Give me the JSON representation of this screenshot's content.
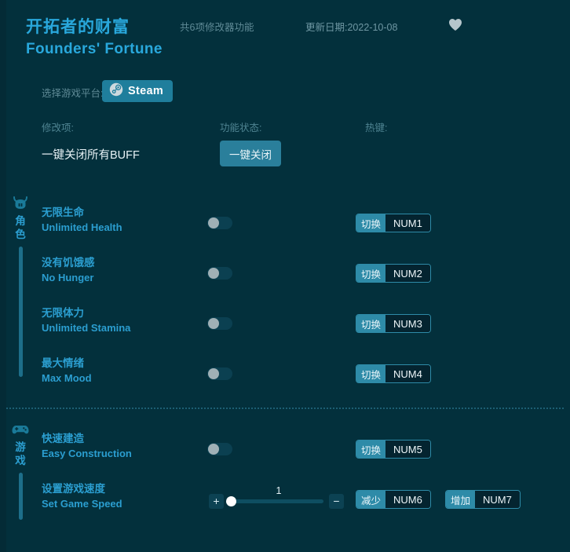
{
  "header": {
    "title_cn": "开拓者的财富",
    "title_en": "Founders' Fortune",
    "feature_count": "共6项修改器功能",
    "update_date": "更新日期:2022-10-08",
    "favorite_icon": "heart-icon",
    "platform_label": "选择游戏平台:",
    "platform_button": "Steam",
    "platform_icon": "steam-icon"
  },
  "columns": {
    "option": "修改项:",
    "status": "功能状态:",
    "hotkey": "热键:"
  },
  "close_all": {
    "label": "一键关闭所有BUFF",
    "button": "一键关闭"
  },
  "colors": {
    "background": "#03303c",
    "accent": "#29a8dc",
    "teal": "#2e8ba8",
    "button": "#2a7f9b",
    "muted": "#5f8a96",
    "rail": "#1d6e8a"
  },
  "sections": [
    {
      "name": "角色",
      "icon": "character-helmet-icon",
      "rows": [
        {
          "cn": "无限生命",
          "en": "Unlimited Health",
          "control": "toggle",
          "toggle_state": "off",
          "hotkeys": [
            {
              "action": "切换",
              "key": "NUM1"
            }
          ]
        },
        {
          "cn": "没有饥饿感",
          "en": "No Hunger",
          "control": "toggle",
          "toggle_state": "off",
          "hotkeys": [
            {
              "action": "切换",
              "key": "NUM2"
            }
          ]
        },
        {
          "cn": "无限体力",
          "en": "Unlimited Stamina",
          "control": "toggle",
          "toggle_state": "off",
          "hotkeys": [
            {
              "action": "切换",
              "key": "NUM3"
            }
          ]
        },
        {
          "cn": "最大情绪",
          "en": "Max Mood",
          "control": "toggle",
          "toggle_state": "off",
          "hotkeys": [
            {
              "action": "切换",
              "key": "NUM4"
            }
          ]
        }
      ]
    },
    {
      "name": "游戏",
      "icon": "gamepad-icon",
      "rows": [
        {
          "cn": "快速建造",
          "en": "Easy Construction",
          "control": "toggle",
          "toggle_state": "off",
          "hotkeys": [
            {
              "action": "切换",
              "key": "NUM5"
            }
          ]
        },
        {
          "cn": "设置游戏速度",
          "en": "Set Game Speed",
          "control": "slider",
          "slider": {
            "value": "1",
            "increase_icon": "plus-icon",
            "decrease_icon": "minus-icon"
          },
          "hotkeys": [
            {
              "action": "减少",
              "key": "NUM6"
            },
            {
              "action": "增加",
              "key": "NUM7"
            }
          ]
        }
      ]
    }
  ]
}
